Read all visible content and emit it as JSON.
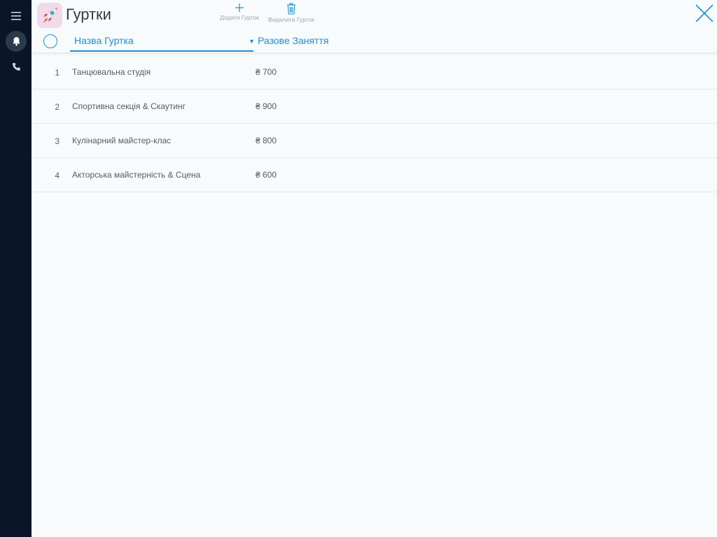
{
  "sidebar": {
    "icons": [
      "menu-icon",
      "bell-icon",
      "phone-icon"
    ]
  },
  "header": {
    "title": "Гуртки",
    "add_label": "Додати Гурток",
    "delete_label": "Видалити Гурток"
  },
  "table": {
    "columns": {
      "name": "Назва Гуртка",
      "price": "Разове Заняття"
    },
    "rows": [
      {
        "num": "1",
        "name": "Танцювальна студія",
        "price": "₴ 700"
      },
      {
        "num": "2",
        "name": "Спортивна секція & Скаутинг",
        "price": "₴ 900"
      },
      {
        "num": "3",
        "name": "Кулінарний майстер-клас",
        "price": "₴ 800"
      },
      {
        "num": "4",
        "name": "Акторська майстерність & Сцена",
        "price": "₴ 600"
      }
    ]
  },
  "colors": {
    "accent": "#1b8fce",
    "sidebar_bg": "#0a1628",
    "page_bg": "#f8fbfc"
  }
}
